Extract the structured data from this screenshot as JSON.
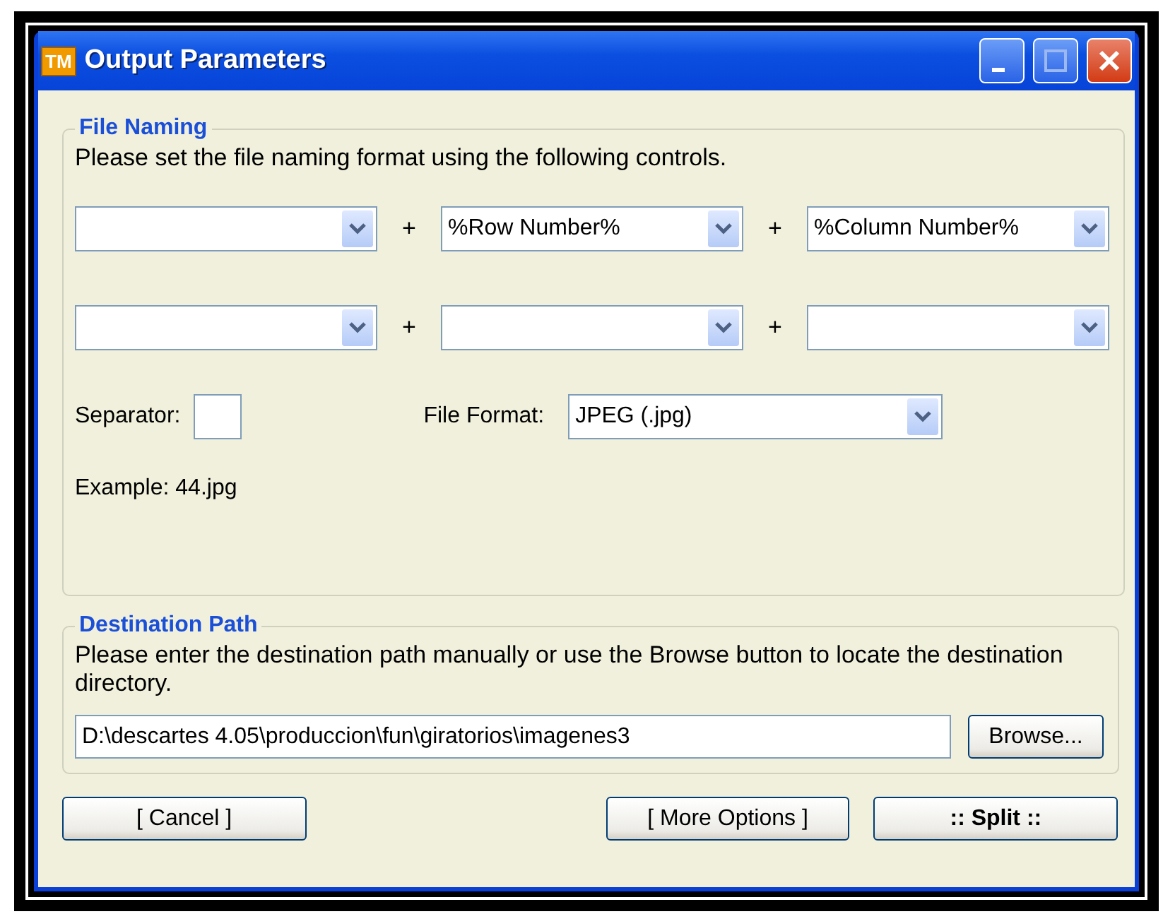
{
  "window": {
    "title": "Output Parameters",
    "logo": "TM"
  },
  "file_naming": {
    "title": "File Naming",
    "description": "Please set the file naming format using the following controls.",
    "rows": [
      {
        "fields": [
          {
            "kind": "empty"
          },
          {
            "kind": "filled",
            "value": "%Row Number%"
          },
          {
            "kind": "filled",
            "value": "%Column Number%"
          }
        ],
        "joiners": [
          "+",
          "+"
        ]
      },
      {
        "fields": [
          {
            "kind": "empty"
          },
          {
            "kind": "empty"
          },
          {
            "kind": "empty"
          }
        ],
        "joiners": [
          "+",
          "+"
        ]
      }
    ],
    "separator_label": "Separator:",
    "file_format_label": "File Format:",
    "file_format": "JPEG (.jpg)",
    "example": "Example: 44.jpg"
  },
  "destination": {
    "title": "Destination Path",
    "description": "Please enter the destination path manually or use the Browse button to locate the destination directory.",
    "path": "D:\\descartes 4.05\\produccion\\fun\\giratorios\\imagenes3",
    "browse": "Browse..."
  },
  "buttons": [
    {
      "label": "[ Cancel ]",
      "kind": "normal"
    },
    {
      "label": "[ More Options ]",
      "kind": "normal"
    },
    {
      "label": ":: Split ::",
      "kind": "primary"
    }
  ]
}
